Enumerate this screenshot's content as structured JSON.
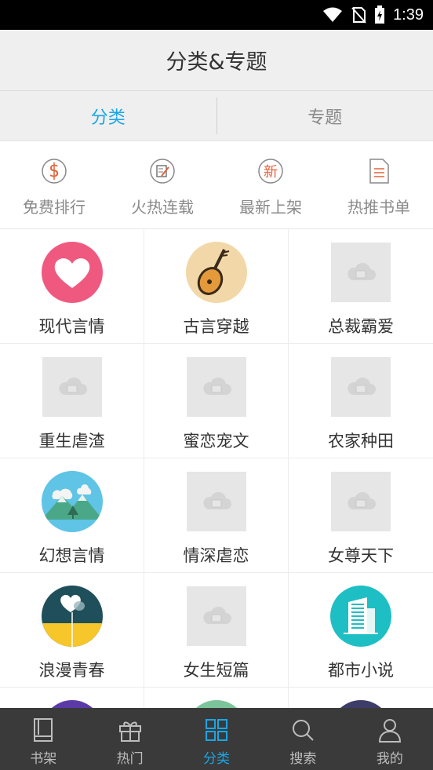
{
  "status": {
    "time": "1:39"
  },
  "header": {
    "title": "分类&专题"
  },
  "tabs": [
    {
      "label": "分类",
      "active": true
    },
    {
      "label": "专题",
      "active": false
    }
  ],
  "quick_links": [
    {
      "label": "免费排行",
      "icon": "dollar-icon"
    },
    {
      "label": "火热连载",
      "icon": "edit-icon"
    },
    {
      "label": "最新上架",
      "icon": "new-icon"
    },
    {
      "label": "热推书单",
      "icon": "document-icon"
    }
  ],
  "categories": [
    [
      {
        "label": "现代言情",
        "icon": "heart-icon"
      },
      {
        "label": "古言穿越",
        "icon": "pipa-icon"
      },
      {
        "label": "总裁霸爱",
        "icon": "cloud-placeholder"
      }
    ],
    [
      {
        "label": "重生虐渣",
        "icon": "cloud-placeholder"
      },
      {
        "label": "蜜恋宠文",
        "icon": "cloud-placeholder"
      },
      {
        "label": "农家种田",
        "icon": "cloud-placeholder"
      }
    ],
    [
      {
        "label": "幻想言情",
        "icon": "mountain-icon"
      },
      {
        "label": "情深虐恋",
        "icon": "cloud-placeholder"
      },
      {
        "label": "女尊天下",
        "icon": "cloud-placeholder"
      }
    ],
    [
      {
        "label": "浪漫青春",
        "icon": "romance-icon"
      },
      {
        "label": "女生短篇",
        "icon": "cloud-placeholder"
      },
      {
        "label": "都市小说",
        "icon": "building-icon"
      }
    ]
  ],
  "colors": {
    "accent": "#1aa6e6",
    "quick_icon": "#e2623a"
  },
  "bottom_nav": [
    {
      "label": "书架",
      "icon": "bookshelf-icon",
      "active": false
    },
    {
      "label": "热门",
      "icon": "gift-icon",
      "active": false
    },
    {
      "label": "分类",
      "icon": "grid-icon",
      "active": true
    },
    {
      "label": "搜索",
      "icon": "search-icon",
      "active": false
    },
    {
      "label": "我的",
      "icon": "user-icon",
      "active": false
    }
  ]
}
